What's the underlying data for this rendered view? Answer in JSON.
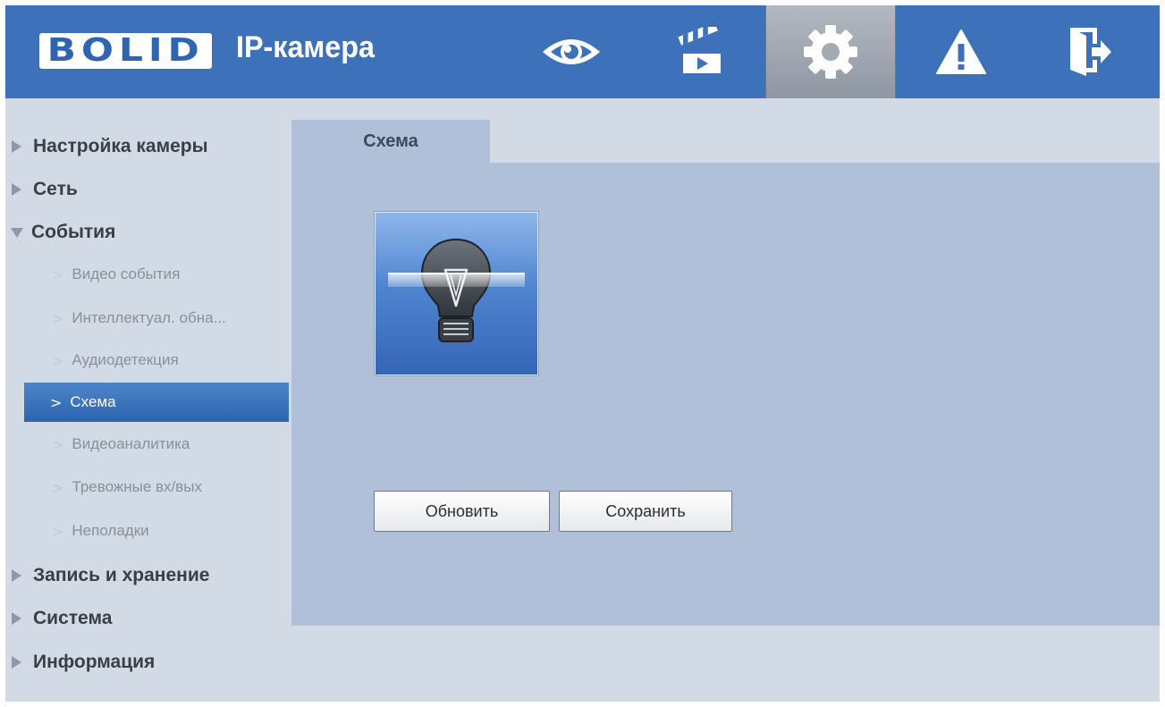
{
  "header": {
    "logo": "BOLID",
    "title": "IP-камера",
    "nav": [
      {
        "icon": "eye-icon",
        "active": false
      },
      {
        "icon": "clapperboard-icon",
        "active": false
      },
      {
        "icon": "gear-icon",
        "active": true
      },
      {
        "icon": "warning-icon",
        "active": false
      },
      {
        "icon": "logout-icon",
        "active": false
      }
    ]
  },
  "sidebar": {
    "sections": [
      {
        "label": "Настройка камеры",
        "expanded": false
      },
      {
        "label": "Сеть",
        "expanded": false
      },
      {
        "label": "События",
        "expanded": true,
        "items": [
          {
            "label": "Видео события",
            "active": false
          },
          {
            "label": "Интеллектуал. обна...",
            "active": false
          },
          {
            "label": "Аудиодетекция",
            "active": false
          },
          {
            "label": "Схема",
            "active": true
          },
          {
            "label": "Видеоаналитика",
            "active": false
          },
          {
            "label": "Тревожные вх/вых",
            "active": false
          },
          {
            "label": "Неполадки",
            "active": false
          }
        ]
      },
      {
        "label": "Запись и хранение",
        "expanded": false
      },
      {
        "label": "Система",
        "expanded": false
      },
      {
        "label": "Информация",
        "expanded": false
      }
    ]
  },
  "main": {
    "tabs": [
      {
        "label": "Схема",
        "active": true
      }
    ],
    "tile_icon": "lightbulb-icon",
    "buttons": {
      "refresh": "Обновить",
      "save": "Сохранить"
    }
  },
  "colors": {
    "header": "#3d72ba",
    "background": "#d2dae6",
    "panel": "#b0c0d8",
    "active_item": "#2b64b0"
  }
}
